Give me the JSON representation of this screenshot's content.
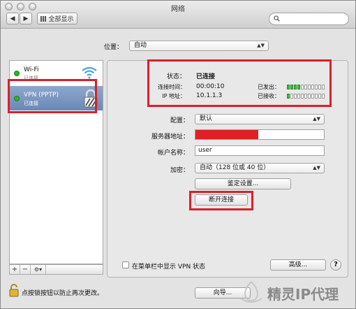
{
  "window": {
    "title": "网络"
  },
  "toolbar": {
    "back_label": "◀",
    "forward_label": "▶",
    "show_all_label": "全部显示",
    "search_placeholder": ""
  },
  "location": {
    "label": "位置：",
    "value": "自动"
  },
  "sidebar": {
    "services": [
      {
        "name": "Wi-Fi",
        "status": "已连接"
      },
      {
        "name": "VPN (PPTP)",
        "status": "已连接"
      }
    ],
    "add_label": "+",
    "remove_label": "−",
    "gear_label": "⚙▾"
  },
  "vpn": {
    "status_label": "状态：",
    "status_value": "已连接",
    "connect_time_label": "连接时间：",
    "connect_time_value": "00:00:10",
    "ip_label": "IP 地址：",
    "ip_value": "10.1.1.3",
    "sent_label": "已发出：",
    "received_label": "已接收：",
    "config_label": "配置：",
    "config_value": "默认",
    "server_label": "服务器地址：",
    "account_label": "帐户名称：",
    "account_value": "user",
    "encryption_label": "加密：",
    "encryption_value": "自动（128 位或 40 位）",
    "auth_button": "鉴定设置...",
    "disconnect_button": "断开连接",
    "menubar_checkbox_label": "在菜单栏中显示 VPN 状态",
    "advanced_button": "高级...",
    "help_label": "?"
  },
  "footer": {
    "lock_text": "点按锁按钮以防止再次更改。",
    "assist_button": "向导..."
  },
  "watermark": {
    "text": "精灵IP代理"
  },
  "colors": {
    "highlight_red": "#d9202a",
    "selection_blue": "#6b89b8",
    "status_green": "#2bb52b"
  }
}
